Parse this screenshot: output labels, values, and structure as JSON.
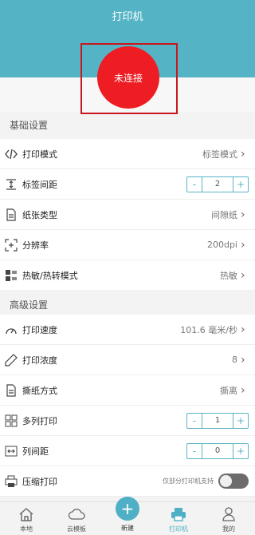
{
  "header": {
    "title": "打印机"
  },
  "status": {
    "label": "未连接",
    "color": "#ee1d23"
  },
  "sections": {
    "basic": "基础设置",
    "advanced": "高级设置"
  },
  "rows": {
    "print_mode": {
      "label": "打印模式",
      "value": "标签模式"
    },
    "label_gap": {
      "label": "标签间距",
      "value": "2",
      "minus": "-",
      "plus": "+"
    },
    "paper_type": {
      "label": "纸张类型",
      "value": "间隙纸"
    },
    "resolution": {
      "label": "分辨率",
      "value": "200dpi"
    },
    "thermal_mode": {
      "label": "热敏/热转模式",
      "value": "热敏"
    },
    "print_speed": {
      "label": "打印速度",
      "value": "101.6 毫米/秒"
    },
    "print_density": {
      "label": "打印浓度",
      "value": "8"
    },
    "tear_mode": {
      "label": "撕纸方式",
      "value": "撕离"
    },
    "multi_column": {
      "label": "多列打印",
      "value": "1",
      "minus": "-",
      "plus": "+"
    },
    "column_gap": {
      "label": "列间距",
      "value": "0",
      "minus": "-",
      "plus": "+"
    },
    "compress_print": {
      "label": "压缩打印",
      "note": "仅部分打印机支持",
      "enabled": false
    }
  },
  "nav": {
    "home": "本地",
    "cloud": "云模板",
    "new": "新建",
    "printer": "打印机",
    "mine": "我的"
  },
  "colors": {
    "accent": "#4fb0c5",
    "header": "#55b3c6"
  }
}
